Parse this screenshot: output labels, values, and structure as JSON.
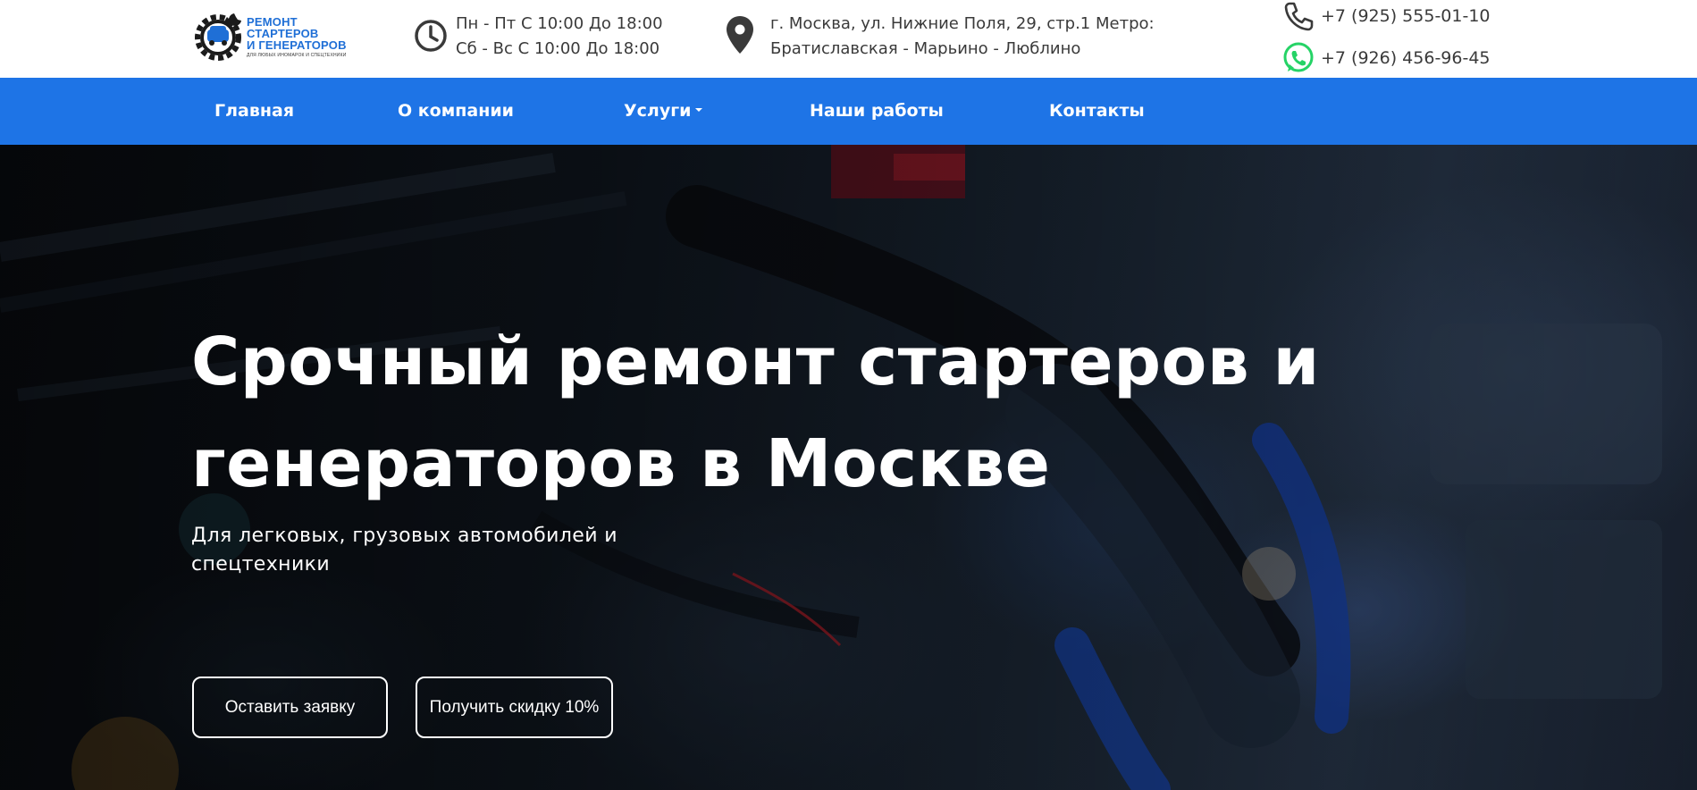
{
  "header": {
    "logo": {
      "line1": "РЕМОНТ",
      "line2": "СТАРТЕРОВ",
      "line3": "И ГЕНЕРАТОРОВ",
      "tagline": "ДЛЯ ЛЮБЫХ ИНОМАРОК И СПЕЦТЕХНИКИ",
      "icon": "gear-wrench-car-logo"
    },
    "hours": {
      "icon": "clock-icon",
      "line1": "Пн - Пт С 10:00 До 18:00",
      "line2": "Сб - Вс С 10:00 До 18:00"
    },
    "address": {
      "icon": "map-pin-icon",
      "line1": "г. Москва, ул. Нижние Поля, 29, стр.1 Метро:",
      "line2": "Братиславская - Марьино - Люблино"
    },
    "phones": [
      {
        "icon": "phone-icon",
        "number": "+7 (925) 555-01-10"
      },
      {
        "icon": "whatsapp-icon",
        "number": "+7 (926) 456-96-45"
      }
    ]
  },
  "nav": {
    "items": [
      {
        "label": "Главная"
      },
      {
        "label": "О компании"
      },
      {
        "label": "Услуги",
        "has_dropdown": true
      },
      {
        "label": "Наши работы"
      },
      {
        "label": "Контакты"
      }
    ]
  },
  "hero": {
    "title_line1": "Срочный ремонт стартеров и",
    "title_line2": "генераторов в Москве",
    "subtitle": "Для легковых, грузовых автомобилей и спецтехники",
    "buttons": {
      "request": "Оставить заявку",
      "discount": "Получить скидку 10%"
    }
  },
  "colors": {
    "brand_blue": "#1e74e6",
    "logo_blue": "#1f6fd6",
    "whatsapp_green": "#25d366",
    "text_dark": "#3a3a3a",
    "white": "#ffffff"
  }
}
